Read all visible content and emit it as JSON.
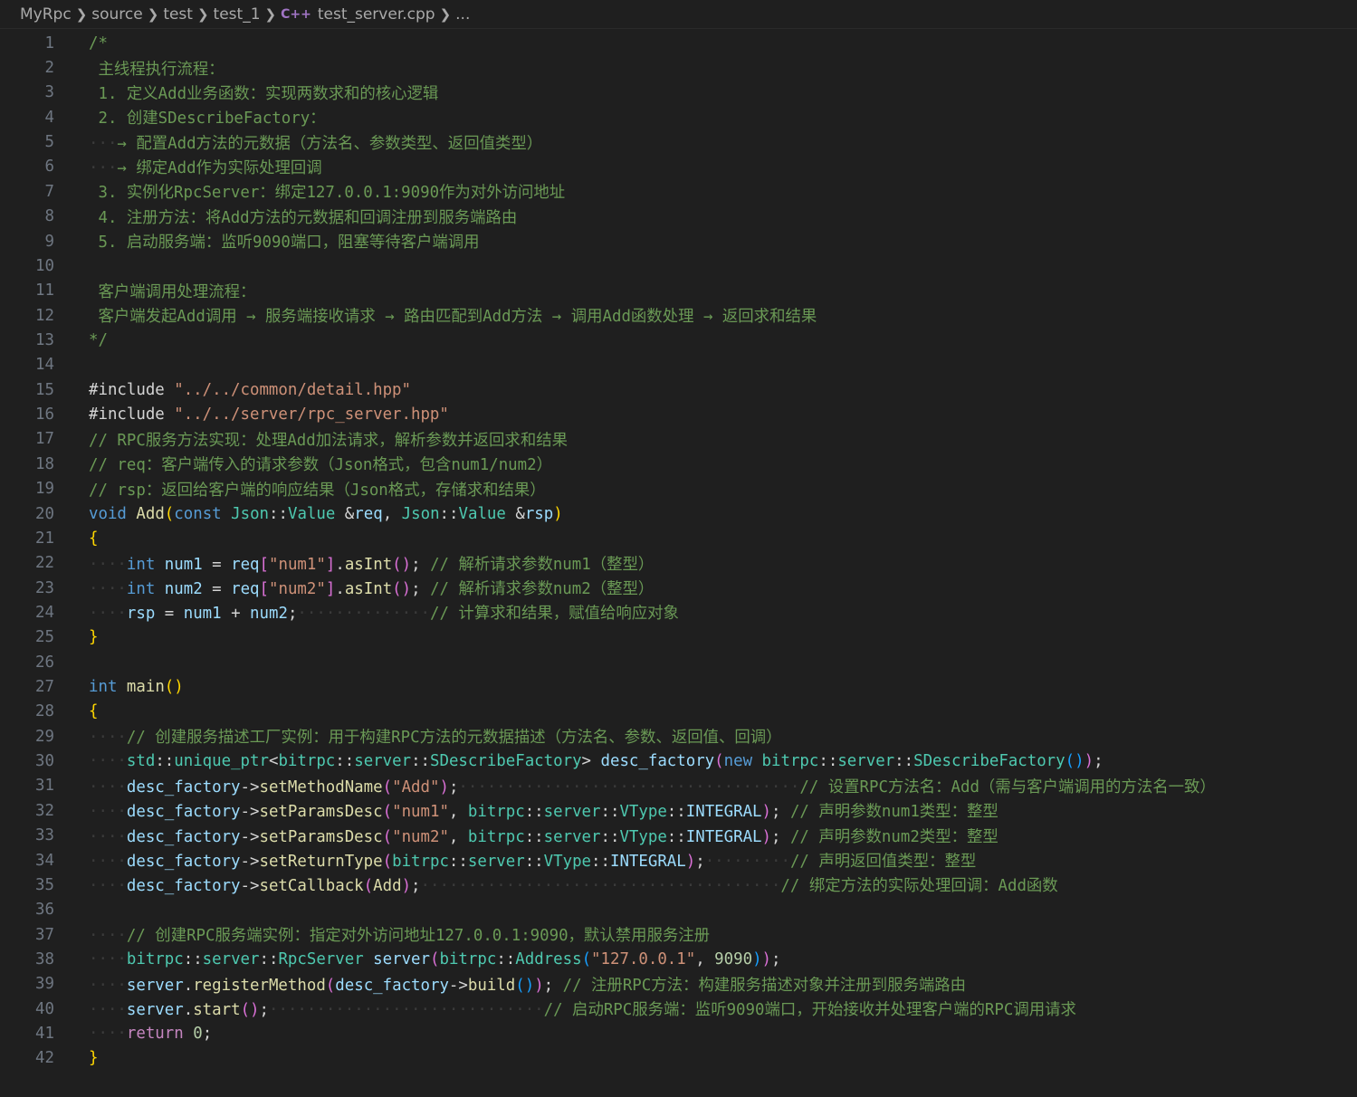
{
  "breadcrumb": {
    "items": [
      "MyRpc",
      "source",
      "test",
      "test_1"
    ],
    "file_icon": "C++",
    "file": "test_server.cpp",
    "more": "..."
  },
  "editor": {
    "lines": [
      [
        [
          "cm",
          "/*"
        ]
      ],
      [
        [
          "cm",
          " 主线程执行流程："
        ]
      ],
      [
        [
          "cm",
          " 1. 定义Add业务函数：实现两数求和的核心逻辑"
        ]
      ],
      [
        [
          "cm",
          " 2. 创建SDescribeFactory："
        ]
      ],
      [
        [
          "ws",
          "···"
        ],
        [
          "cm",
          "→ 配置Add方法的元数据（方法名、参数类型、返回值类型）"
        ]
      ],
      [
        [
          "ws",
          "···"
        ],
        [
          "cm",
          "→ 绑定Add作为实际处理回调"
        ]
      ],
      [
        [
          "cm",
          " 3. 实例化RpcServer：绑定127.0.0.1:9090作为对外访问地址"
        ]
      ],
      [
        [
          "cm",
          " 4. 注册方法：将Add方法的元数据和回调注册到服务端路由"
        ]
      ],
      [
        [
          "cm",
          " 5. 启动服务端：监听9090端口，阻塞等待客户端调用"
        ]
      ],
      [],
      [
        [
          "cm",
          " 客户端调用处理流程："
        ]
      ],
      [
        [
          "cm",
          " 客户端发起Add调用 → 服务端接收请求 → 路由匹配到Add方法 → 调用Add函数处理 → 返回求和结果"
        ]
      ],
      [
        [
          "cm",
          "*/"
        ]
      ],
      [],
      [
        [
          "df",
          "#include "
        ],
        [
          "st",
          "\"../../common/detail.hpp\""
        ]
      ],
      [
        [
          "df",
          "#include "
        ],
        [
          "st",
          "\"../../server/rpc_server.hpp\""
        ]
      ],
      [
        [
          "cm",
          "// RPC服务方法实现：处理Add加法请求，解析参数并返回求和结果"
        ]
      ],
      [
        [
          "cm",
          "// req：客户端传入的请求参数（Json格式，包含num1/num2）"
        ]
      ],
      [
        [
          "cm",
          "// rsp：返回给客户端的响应结果（Json格式，存储求和结果）"
        ]
      ],
      [
        [
          "kw",
          "void"
        ],
        [
          "pl",
          " "
        ],
        [
          "fn",
          "Add"
        ],
        [
          "br1",
          "("
        ],
        [
          "kw",
          "const"
        ],
        [
          "pl",
          " "
        ],
        [
          "ty",
          "Json"
        ],
        [
          "pl",
          "::"
        ],
        [
          "ty",
          "Value"
        ],
        [
          "pl",
          " &"
        ],
        [
          "va",
          "req"
        ],
        [
          "pl",
          ", "
        ],
        [
          "ty",
          "Json"
        ],
        [
          "pl",
          "::"
        ],
        [
          "ty",
          "Value"
        ],
        [
          "pl",
          " &"
        ],
        [
          "va",
          "rsp"
        ],
        [
          "br1",
          ")"
        ]
      ],
      [
        [
          "br1",
          "{"
        ]
      ],
      [
        [
          "ws",
          "····"
        ],
        [
          "kw",
          "int"
        ],
        [
          "pl",
          " "
        ],
        [
          "va",
          "num1"
        ],
        [
          "pl",
          " = "
        ],
        [
          "va",
          "req"
        ],
        [
          "br2",
          "["
        ],
        [
          "st",
          "\"num1\""
        ],
        [
          "br2",
          "]"
        ],
        [
          "pl",
          "."
        ],
        [
          "fn",
          "asInt"
        ],
        [
          "br2",
          "()"
        ],
        [
          "pl",
          "; "
        ],
        [
          "cm",
          "// 解析请求参数num1（整型）"
        ]
      ],
      [
        [
          "ws",
          "····"
        ],
        [
          "kw",
          "int"
        ],
        [
          "pl",
          " "
        ],
        [
          "va",
          "num2"
        ],
        [
          "pl",
          " = "
        ],
        [
          "va",
          "req"
        ],
        [
          "br2",
          "["
        ],
        [
          "st",
          "\"num2\""
        ],
        [
          "br2",
          "]"
        ],
        [
          "pl",
          "."
        ],
        [
          "fn",
          "asInt"
        ],
        [
          "br2",
          "()"
        ],
        [
          "pl",
          "; "
        ],
        [
          "cm",
          "// 解析请求参数num2（整型）"
        ]
      ],
      [
        [
          "ws",
          "····"
        ],
        [
          "va",
          "rsp"
        ],
        [
          "pl",
          " = "
        ],
        [
          "va",
          "num1"
        ],
        [
          "pl",
          " + "
        ],
        [
          "va",
          "num2"
        ],
        [
          "pl",
          ";"
        ],
        [
          "ws",
          "··············"
        ],
        [
          "cm",
          "// 计算求和结果，赋值给响应对象"
        ]
      ],
      [
        [
          "br1",
          "}"
        ]
      ],
      [],
      [
        [
          "kw",
          "int"
        ],
        [
          "pl",
          " "
        ],
        [
          "fn",
          "main"
        ],
        [
          "br1",
          "()"
        ]
      ],
      [
        [
          "br1",
          "{"
        ]
      ],
      [
        [
          "ws",
          "····"
        ],
        [
          "cm",
          "// 创建服务描述工厂实例：用于构建RPC方法的元数据描述（方法名、参数、返回值、回调）"
        ]
      ],
      [
        [
          "ws",
          "····"
        ],
        [
          "ty",
          "std"
        ],
        [
          "pl",
          "::"
        ],
        [
          "ty",
          "unique_ptr"
        ],
        [
          "pl",
          "<"
        ],
        [
          "ty",
          "bitrpc"
        ],
        [
          "pl",
          "::"
        ],
        [
          "ty",
          "server"
        ],
        [
          "pl",
          "::"
        ],
        [
          "ty",
          "SDescribeFactory"
        ],
        [
          "pl",
          "> "
        ],
        [
          "va",
          "desc_factory"
        ],
        [
          "br2",
          "("
        ],
        [
          "kw",
          "new"
        ],
        [
          "pl",
          " "
        ],
        [
          "ty",
          "bitrpc"
        ],
        [
          "pl",
          "::"
        ],
        [
          "ty",
          "server"
        ],
        [
          "pl",
          "::"
        ],
        [
          "ty",
          "SDescribeFactory"
        ],
        [
          "br3",
          "()"
        ],
        [
          "br2",
          ")"
        ],
        [
          "pl",
          ";"
        ]
      ],
      [
        [
          "ws",
          "····"
        ],
        [
          "va",
          "desc_factory"
        ],
        [
          "pl",
          "->"
        ],
        [
          "fn",
          "setMethodName"
        ],
        [
          "br2",
          "("
        ],
        [
          "st",
          "\"Add\""
        ],
        [
          "br2",
          ")"
        ],
        [
          "pl",
          ";"
        ],
        [
          "ws",
          "····································"
        ],
        [
          "cm",
          "// 设置RPC方法名：Add（需与客户端调用的方法名一致）"
        ]
      ],
      [
        [
          "ws",
          "····"
        ],
        [
          "va",
          "desc_factory"
        ],
        [
          "pl",
          "->"
        ],
        [
          "fn",
          "setParamsDesc"
        ],
        [
          "br2",
          "("
        ],
        [
          "st",
          "\"num1\""
        ],
        [
          "pl",
          ", "
        ],
        [
          "ty",
          "bitrpc"
        ],
        [
          "pl",
          "::"
        ],
        [
          "ty",
          "server"
        ],
        [
          "pl",
          "::"
        ],
        [
          "ty",
          "VType"
        ],
        [
          "pl",
          "::"
        ],
        [
          "va",
          "INTEGRAL"
        ],
        [
          "br2",
          ")"
        ],
        [
          "pl",
          "; "
        ],
        [
          "cm",
          "// 声明参数num1类型：整型"
        ]
      ],
      [
        [
          "ws",
          "····"
        ],
        [
          "va",
          "desc_factory"
        ],
        [
          "pl",
          "->"
        ],
        [
          "fn",
          "setParamsDesc"
        ],
        [
          "br2",
          "("
        ],
        [
          "st",
          "\"num2\""
        ],
        [
          "pl",
          ", "
        ],
        [
          "ty",
          "bitrpc"
        ],
        [
          "pl",
          "::"
        ],
        [
          "ty",
          "server"
        ],
        [
          "pl",
          "::"
        ],
        [
          "ty",
          "VType"
        ],
        [
          "pl",
          "::"
        ],
        [
          "va",
          "INTEGRAL"
        ],
        [
          "br2",
          ")"
        ],
        [
          "pl",
          "; "
        ],
        [
          "cm",
          "// 声明参数num2类型：整型"
        ]
      ],
      [
        [
          "ws",
          "····"
        ],
        [
          "va",
          "desc_factory"
        ],
        [
          "pl",
          "->"
        ],
        [
          "fn",
          "setReturnType"
        ],
        [
          "br2",
          "("
        ],
        [
          "ty",
          "bitrpc"
        ],
        [
          "pl",
          "::"
        ],
        [
          "ty",
          "server"
        ],
        [
          "pl",
          "::"
        ],
        [
          "ty",
          "VType"
        ],
        [
          "pl",
          "::"
        ],
        [
          "va",
          "INTEGRAL"
        ],
        [
          "br2",
          ")"
        ],
        [
          "pl",
          ";"
        ],
        [
          "ws",
          "·········"
        ],
        [
          "cm",
          "// 声明返回值类型：整型"
        ]
      ],
      [
        [
          "ws",
          "····"
        ],
        [
          "va",
          "desc_factory"
        ],
        [
          "pl",
          "->"
        ],
        [
          "fn",
          "setCallback"
        ],
        [
          "br2",
          "("
        ],
        [
          "fn",
          "Add"
        ],
        [
          "br2",
          ")"
        ],
        [
          "pl",
          ";"
        ],
        [
          "ws",
          "······································"
        ],
        [
          "cm",
          "// 绑定方法的实际处理回调：Add函数"
        ]
      ],
      [],
      [
        [
          "ws",
          "····"
        ],
        [
          "cm",
          "// 创建RPC服务端实例：指定对外访问地址127.0.0.1:9090，默认禁用服务注册"
        ]
      ],
      [
        [
          "ws",
          "····"
        ],
        [
          "ty",
          "bitrpc"
        ],
        [
          "pl",
          "::"
        ],
        [
          "ty",
          "server"
        ],
        [
          "pl",
          "::"
        ],
        [
          "ty",
          "RpcServer"
        ],
        [
          "pl",
          " "
        ],
        [
          "va",
          "server"
        ],
        [
          "br2",
          "("
        ],
        [
          "ty",
          "bitrpc"
        ],
        [
          "pl",
          "::"
        ],
        [
          "ty",
          "Address"
        ],
        [
          "br3",
          "("
        ],
        [
          "st",
          "\"127.0.0.1\""
        ],
        [
          "pl",
          ", "
        ],
        [
          "nu",
          "9090"
        ],
        [
          "br3",
          ")"
        ],
        [
          "br2",
          ")"
        ],
        [
          "pl",
          ";"
        ]
      ],
      [
        [
          "ws",
          "····"
        ],
        [
          "va",
          "server"
        ],
        [
          "pl",
          "."
        ],
        [
          "fn",
          "registerMethod"
        ],
        [
          "br2",
          "("
        ],
        [
          "va",
          "desc_factory"
        ],
        [
          "pl",
          "->"
        ],
        [
          "fn",
          "build"
        ],
        [
          "br3",
          "()"
        ],
        [
          "br2",
          ")"
        ],
        [
          "pl",
          "; "
        ],
        [
          "cm",
          "// 注册RPC方法：构建服务描述对象并注册到服务端路由"
        ]
      ],
      [
        [
          "ws",
          "····"
        ],
        [
          "va",
          "server"
        ],
        [
          "pl",
          "."
        ],
        [
          "fn",
          "start"
        ],
        [
          "br2",
          "()"
        ],
        [
          "pl",
          ";"
        ],
        [
          "ws",
          "·····························"
        ],
        [
          "cm",
          "// 启动RPC服务端：监听9090端口，开始接收并处理客户端的RPC调用请求"
        ]
      ],
      [
        [
          "ws",
          "····"
        ],
        [
          "pp",
          "return"
        ],
        [
          "pl",
          " "
        ],
        [
          "nu",
          "0"
        ],
        [
          "pl",
          ";"
        ]
      ],
      [
        [
          "br1",
          "}"
        ]
      ]
    ]
  }
}
